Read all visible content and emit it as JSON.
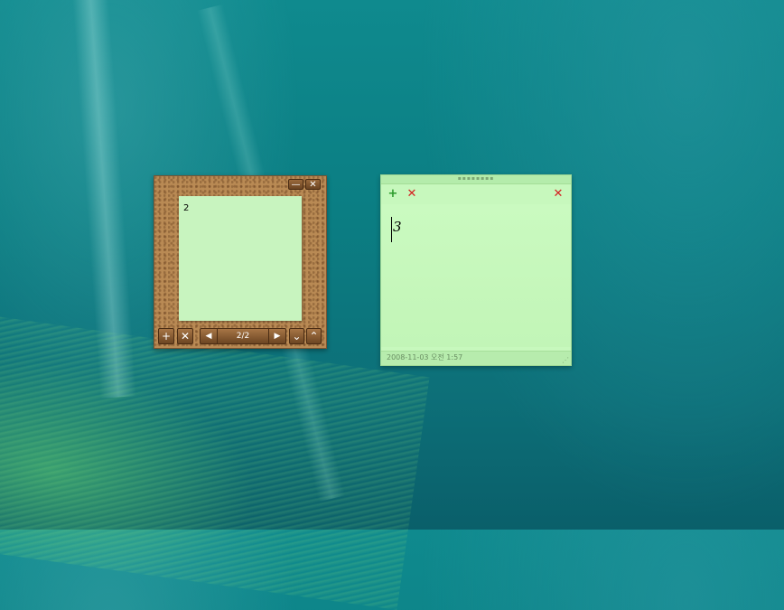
{
  "cork_board": {
    "minimize_label": "—",
    "close_label": "✕",
    "note_text": "2",
    "add_label": "+",
    "delete_label": "✕",
    "prev_label": "◀",
    "page_indicator": "2/2",
    "next_label": "▶",
    "collapse_label": "⌄",
    "expand_label": "⌃"
  },
  "sticky_note": {
    "grip_label": "▪▪▪▪▪▪▪▪",
    "add_label": "+",
    "delete_label": "✕",
    "close_label": "✕",
    "text": "3",
    "timestamp": "2008-11-03 오전 1:57",
    "resize_glyph": "⋰"
  },
  "colors": {
    "add_green": "#2a9a2a",
    "delete_red": "#d42020",
    "note_bg": "#c7f8bd",
    "cork": "#b98a54"
  }
}
